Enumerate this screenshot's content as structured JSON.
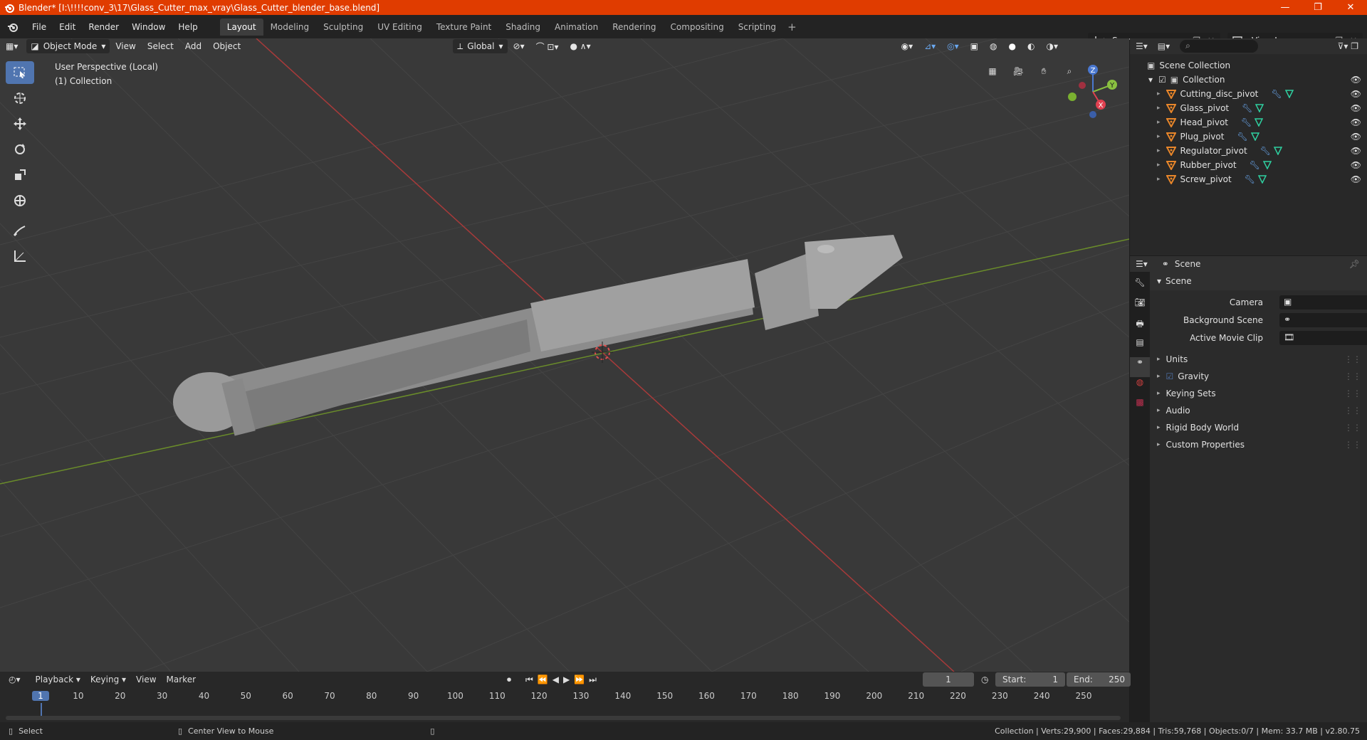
{
  "title_bar": {
    "text": "Blender* [I:\\!!!!conv_3\\17\\Glass_Cutter_max_vray\\Glass_Cutter_blender_base.blend]",
    "minimize": "—",
    "maximize": "❐",
    "close": "✕"
  },
  "menu": [
    "File",
    "Edit",
    "Render",
    "Window",
    "Help"
  ],
  "workspaces": [
    "Layout",
    "Modeling",
    "Sculpting",
    "UV Editing",
    "Texture Paint",
    "Shading",
    "Animation",
    "Rendering",
    "Compositing",
    "Scripting"
  ],
  "active_workspace": "Layout",
  "scene_name": "Scene",
  "view_layer": "View Layer",
  "viewport": {
    "mode": "Object Mode",
    "menus": [
      "View",
      "Select",
      "Add",
      "Object"
    ],
    "orientation": "Global",
    "info_line1": "User Perspective (Local)",
    "info_line2": "(1) Collection",
    "gizmo": {
      "x": "X",
      "y": "Y",
      "z": "Z"
    }
  },
  "outliner": {
    "root": "Scene Collection",
    "collection": "Collection",
    "items": [
      "Cutting_disc_pivot",
      "Glass_pivot",
      "Head_pivot",
      "Plug_pivot",
      "Regulator_pivot",
      "Rubber_pivot",
      "Screw_pivot"
    ]
  },
  "properties": {
    "header": "Scene",
    "section": "Scene",
    "fields": [
      "Camera",
      "Background Scene",
      "Active Movie Clip"
    ],
    "panels": [
      "Units",
      "Gravity",
      "Keying Sets",
      "Audio",
      "Rigid Body World",
      "Custom Properties"
    ]
  },
  "timeline": {
    "menus": [
      "Playback",
      "Keying",
      "View",
      "Marker"
    ],
    "current_frame": "1",
    "start_label": "Start:",
    "start": "1",
    "end_label": "End:",
    "end": "250",
    "ticks": [
      "1",
      "10",
      "20",
      "30",
      "40",
      "50",
      "60",
      "70",
      "80",
      "90",
      "100",
      "110",
      "120",
      "130",
      "140",
      "150",
      "160",
      "170",
      "180",
      "190",
      "200",
      "210",
      "220",
      "230",
      "240",
      "250"
    ]
  },
  "status": {
    "left_action": "Select",
    "mid_action": "Center View to Mouse",
    "stats": "Collection | Verts:29,900 | Faces:29,884 | Tris:59,768 | Objects:0/7 | Mem: 33.7 MB | v2.80.75"
  },
  "colors": {
    "title": "#e03c00",
    "accent": "#5075b0",
    "object_icon": "#e8862a",
    "modifier_icon": "#6aa8f0",
    "mesh_icon": "#2fd0a0"
  }
}
